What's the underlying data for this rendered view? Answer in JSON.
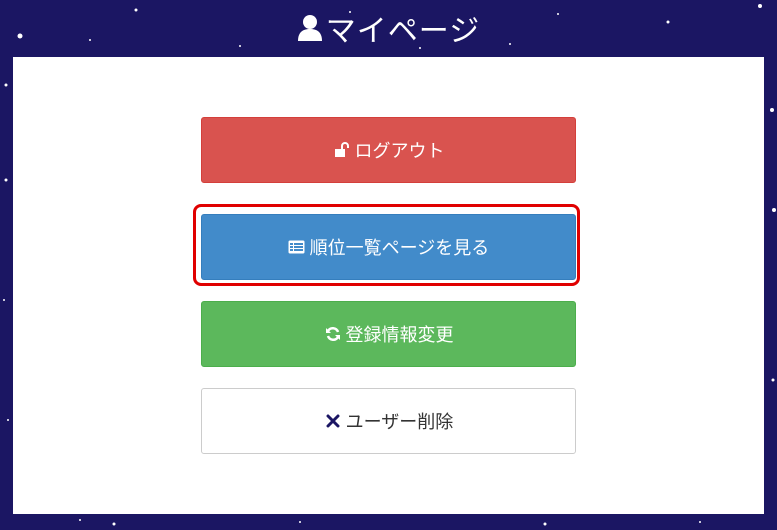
{
  "header": {
    "title": "マイページ",
    "icon": "user-icon"
  },
  "buttons": [
    {
      "label": "ログアウト",
      "icon": "unlock-icon",
      "color": "#d9534f"
    },
    {
      "label": "順位一覧ページを見る",
      "icon": "list-icon",
      "color": "#428bca"
    },
    {
      "label": "登録情報変更",
      "icon": "refresh-icon",
      "color": "#5cb85c"
    },
    {
      "label": "ユーザー削除",
      "icon": "close-icon",
      "color": "#ffffff"
    }
  ],
  "highlight": {
    "color": "#e00000"
  },
  "colors": {
    "background": "#1b1663",
    "panel": "#ffffff"
  }
}
